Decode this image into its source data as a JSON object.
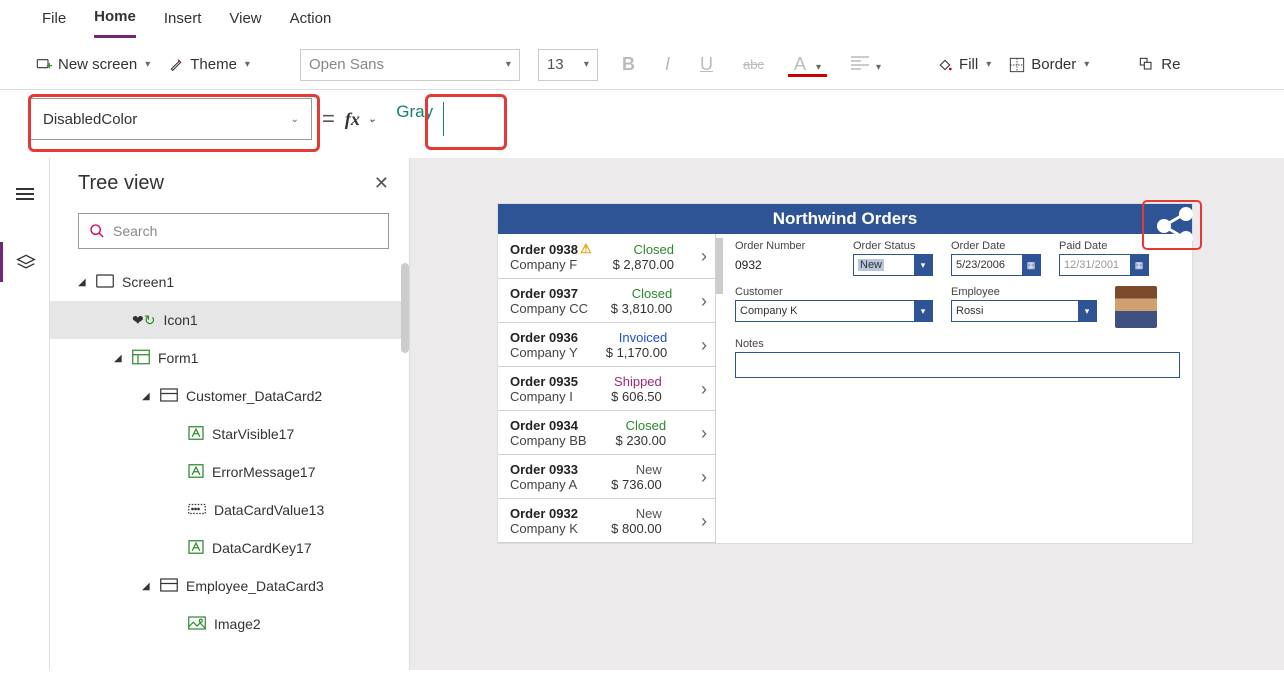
{
  "menu": {
    "items": [
      "File",
      "Home",
      "Insert",
      "View",
      "Action"
    ],
    "active": "Home"
  },
  "ribbon": {
    "new_screen": "New screen",
    "theme": "Theme",
    "font": "Open Sans",
    "size": "13",
    "fill": "Fill",
    "border": "Border",
    "reorder": "Re"
  },
  "formula": {
    "property": "DisabledColor",
    "value": "Gray"
  },
  "tree": {
    "title": "Tree view",
    "search_placeholder": "Search",
    "items": [
      {
        "label": "Screen1",
        "level": 0,
        "icon": "screen",
        "expanded": true
      },
      {
        "label": "Icon1",
        "level": 1,
        "icon": "icon",
        "selected": true
      },
      {
        "label": "Form1",
        "level": 1,
        "icon": "form",
        "expanded": true
      },
      {
        "label": "Customer_DataCard2",
        "level": 2,
        "icon": "card",
        "expanded": true
      },
      {
        "label": "StarVisible17",
        "level": 3,
        "icon": "label"
      },
      {
        "label": "ErrorMessage17",
        "level": 3,
        "icon": "label"
      },
      {
        "label": "DataCardValue13",
        "level": 3,
        "icon": "input"
      },
      {
        "label": "DataCardKey17",
        "level": 3,
        "icon": "label"
      },
      {
        "label": "Employee_DataCard3",
        "level": 2,
        "icon": "card",
        "expanded": true
      },
      {
        "label": "Image2",
        "level": 3,
        "icon": "image"
      }
    ]
  },
  "app": {
    "title": "Northwind Orders",
    "orders": [
      {
        "num": "Order 0938",
        "company": "Company F",
        "status": "Closed",
        "status_cls": "closed",
        "amount": "$ 2,870.00",
        "warn": true
      },
      {
        "num": "Order 0937",
        "company": "Company CC",
        "status": "Closed",
        "status_cls": "closed",
        "amount": "$ 3,810.00"
      },
      {
        "num": "Order 0936",
        "company": "Company Y",
        "status": "Invoiced",
        "status_cls": "invoiced",
        "amount": "$ 1,170.00"
      },
      {
        "num": "Order 0935",
        "company": "Company I",
        "status": "Shipped",
        "status_cls": "shipped",
        "amount": "$ 606.50"
      },
      {
        "num": "Order 0934",
        "company": "Company BB",
        "status": "Closed",
        "status_cls": "closed",
        "amount": "$ 230.00"
      },
      {
        "num": "Order 0933",
        "company": "Company A",
        "status": "New",
        "status_cls": "new",
        "amount": "$ 736.00"
      },
      {
        "num": "Order 0932",
        "company": "Company K",
        "status": "New",
        "status_cls": "new",
        "amount": "$ 800.00"
      }
    ],
    "form": {
      "order_number_label": "Order Number",
      "order_number": "0932",
      "order_status_label": "Order Status",
      "order_status": "New",
      "order_date_label": "Order Date",
      "order_date": "5/23/2006",
      "paid_date_label": "Paid Date",
      "paid_date": "12/31/2001",
      "customer_label": "Customer",
      "customer": "Company K",
      "employee_label": "Employee",
      "employee": "Rossi",
      "notes_label": "Notes"
    }
  }
}
